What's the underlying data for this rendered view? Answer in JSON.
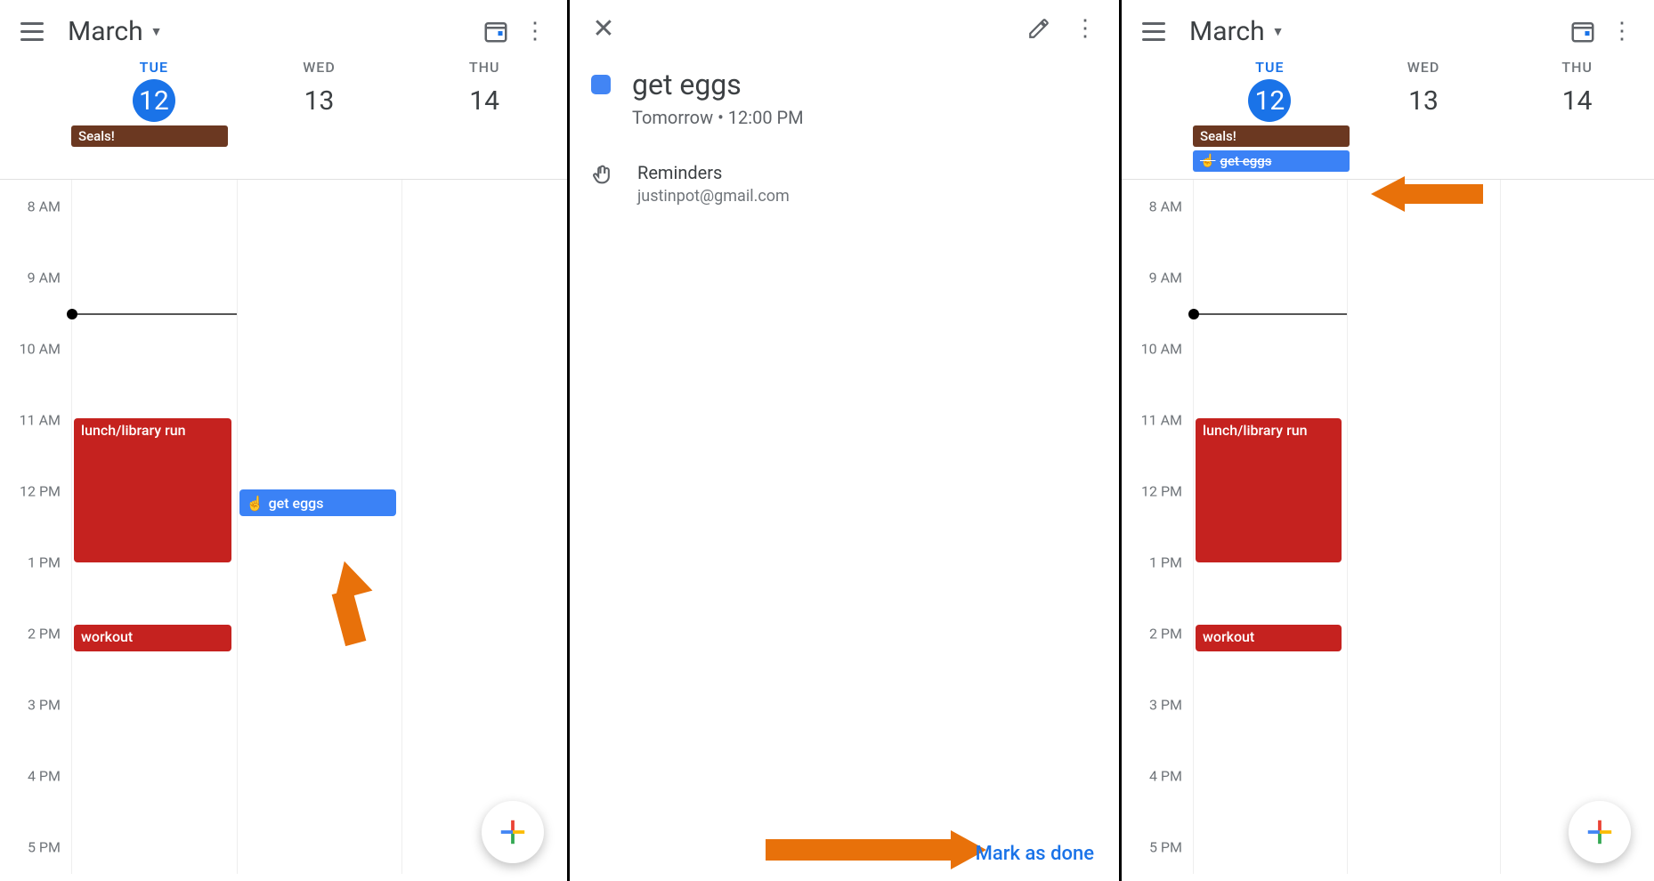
{
  "month_label": "March",
  "days": [
    {
      "abbr": "TUE",
      "num": "12",
      "active": true
    },
    {
      "abbr": "WED",
      "num": "13",
      "active": false
    },
    {
      "abbr": "THU",
      "num": "14",
      "active": false
    }
  ],
  "time_labels": [
    "8 AM",
    "9 AM",
    "10 AM",
    "11 AM",
    "12 PM",
    "1 PM",
    "2 PM",
    "3 PM",
    "4 PM",
    "5 PM"
  ],
  "events": {
    "seals": "Seals!",
    "lunch": "lunch/library run",
    "workout": "workout",
    "geteggs": "get eggs",
    "geteggs_done": "get eggs"
  },
  "detail": {
    "title": "get eggs",
    "subtitle": "Tomorrow  •  12:00 PM",
    "section_label": "Reminders",
    "email": "justinpot@gmail.com",
    "mark_done": "Mark as done"
  },
  "colors": {
    "brown": "#6b3821",
    "red": "#c5221f",
    "blue": "#3b82f6",
    "google_blue": "#1a73e8",
    "arrow": "#e8710a"
  }
}
